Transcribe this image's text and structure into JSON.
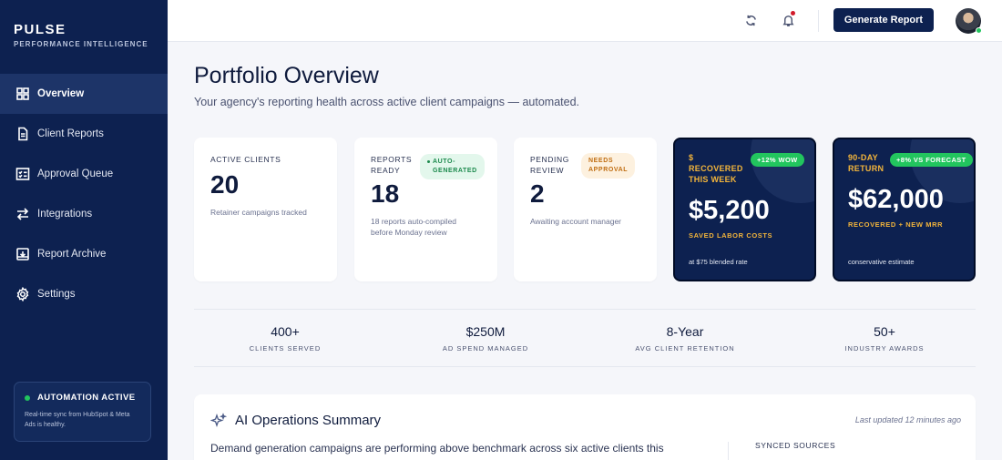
{
  "brand": {
    "name": "PULSE",
    "tagline": "PERFORMANCE INTELLIGENCE"
  },
  "sidebar": {
    "items": [
      {
        "label": "Overview",
        "icon": "grid-icon",
        "active": true
      },
      {
        "label": "Client Reports",
        "icon": "document-icon"
      },
      {
        "label": "Approval Queue",
        "icon": "checklist-icon"
      },
      {
        "label": "Integrations",
        "icon": "arrows-swap-icon"
      },
      {
        "label": "Report Archive",
        "icon": "archive-icon"
      },
      {
        "label": "Settings",
        "icon": "gear-icon"
      }
    ],
    "automation": {
      "title": "AUTOMATION ACTIVE",
      "text": "Real-time sync from HubSpot & Meta Ads is healthy."
    }
  },
  "topbar": {
    "generate_label": "Generate Report"
  },
  "page": {
    "title": "Portfolio Overview",
    "subtitle": "Your agency's reporting health across active client campaigns — automated."
  },
  "kpis": [
    {
      "label": "ACTIVE CLIENTS",
      "value": "20",
      "desc": "Retainer campaigns tracked"
    },
    {
      "label_line1": "REPORTS",
      "label_line2": "READY",
      "value": "18",
      "desc_line1": "18 reports auto-compiled",
      "desc_line2": "before Monday review",
      "badge_line1": "AUTO-",
      "badge_line2": "GENERATED"
    },
    {
      "label_line1": "PENDING",
      "label_line2": "REVIEW",
      "value": "2",
      "desc": "Awaiting account manager",
      "badge_line1": "NEEDS",
      "badge_line2": "APPROVAL"
    }
  ],
  "highlights": [
    {
      "label_line1": "$",
      "label_line2": "RECOVERED",
      "label_line3": "THIS WEEK",
      "badge": "+12% WOW",
      "value": "$5,200",
      "caption": "SAVED LABOR COSTS",
      "note": "at $75 blended rate"
    },
    {
      "label_line1": "90-DAY",
      "label_line2": "RETURN",
      "badge": "+8% VS FORECAST",
      "value": "$62,000",
      "caption": "RECOVERED + NEW MRR",
      "note": "conservative estimate"
    }
  ],
  "stats": [
    {
      "value": "400+",
      "label": "CLIENTS SERVED"
    },
    {
      "value": "$250M",
      "label": "AD SPEND MANAGED"
    },
    {
      "value": "8-Year",
      "label": "AVG CLIENT RETENTION"
    },
    {
      "value": "50+",
      "label": "INDUSTRY AWARDS"
    }
  ],
  "ai_summary": {
    "title": "AI Operations Summary",
    "updated": "Last updated 12 minutes ago",
    "text": "Demand generation campaigns are performing above benchmark across six active clients this",
    "sources_label": "SYNCED SOURCES"
  },
  "colors": {
    "navy": "#0d2150",
    "accent_gold": "#f3b53b",
    "success": "#22c55e"
  }
}
